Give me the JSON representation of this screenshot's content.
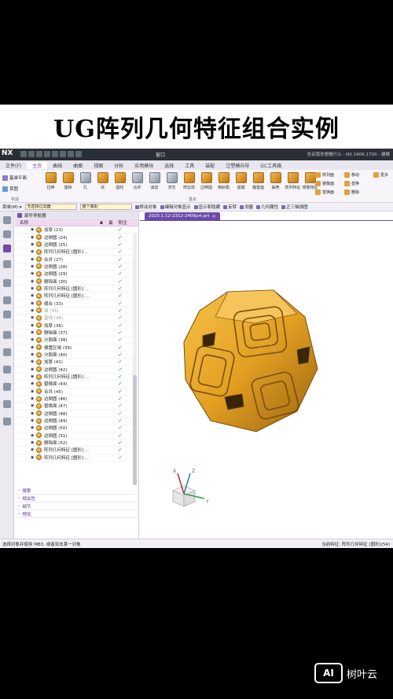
{
  "headline": "UG阵列几何特征组合实例",
  "titlebar": {
    "app": "NX",
    "window_menu": "窗口",
    "right_text": "告诉我你想做什么 - NX 2406.1700 - 建模"
  },
  "menubar": [
    "文件(F)",
    "主页",
    "曲线",
    "曲面",
    "视图",
    "分析",
    "应用模块",
    "选择",
    "工具",
    "装配",
    "注塑模向导",
    "GC工具箱"
  ],
  "menubar_active_index": 1,
  "ribbon": {
    "left": [
      "基准平面",
      "草图"
    ],
    "buttons": [
      "拉伸",
      "旋转",
      "孔",
      "块",
      "圆柱",
      "合并",
      "减去",
      "求交",
      "修剪体",
      "边倒圆",
      "倒斜角",
      "拔模",
      "偏置面",
      "抽壳",
      "阵列特征",
      "镜像特征"
    ],
    "col1": [
      "阵列面",
      "镜像面",
      "替换面"
    ],
    "col2": [
      "移动",
      "替换",
      "删除"
    ],
    "col3": [
      "更多"
    ],
    "group_labels": [
      "构造",
      "基本"
    ]
  },
  "toolbar": {
    "menu": "菜单(M) ▾",
    "filter": "无选择过滤器",
    "scope": "整个装配",
    "commands": [
      "移动对象",
      "编辑对象显示",
      "显示和隐藏",
      "反转",
      "测量",
      "几何属性",
      "正三轴测图"
    ]
  },
  "navigator": {
    "title": "部件导航器",
    "columns": {
      "name": "名称",
      "latest": "▲",
      "mod": "最",
      "note": "附注"
    },
    "features": [
      "加厚 (23)",
      "边倒圆 (24)",
      "边倒圆 (25)",
      "阵列几何特征 [圆形] ...",
      "合并 (27)",
      "边倒圆 (28)",
      "边倒圆 (29)",
      "删除面 (30)",
      "阵列几何特征 [圆形] ...",
      "阵列几何特征 [圆形] ...",
      "缝合 (33)",
      "球 (35)",
      "直线 (34)",
      "加厚 (36)",
      "删除面 (37)",
      "分割面 (38)",
      "偏置区域 (39)",
      "分割面 (40)",
      "加厚 (41)",
      "边倒圆 (42)",
      "阵列几何特征 [圆形] ...",
      "替换面 (44)",
      "合并 (45)",
      "边倒圆 (46)",
      "替换面 (47)",
      "边倒圆 (48)",
      "边倒圆 (49)",
      "边倒圆 (50)",
      "边倒圆 (51)",
      "删除面 (52)",
      "阵列几何特征 [圆形] ...",
      "阵列几何特征 [圆形] ..."
    ],
    "dimmed_indexes": [
      11,
      12
    ],
    "panels": [
      "搜索",
      "相关性",
      "细节",
      "预览"
    ]
  },
  "graphics": {
    "tab": "2025.1.12-2312-2406prt.prt",
    "model_color": "#e3a022",
    "triad": {
      "x": "X",
      "y": "Y",
      "z": "Z"
    }
  },
  "status": {
    "left": "选择对象并使用 MB3, 或者双击某一对象",
    "right": "当前特征: 阵列几何特征 [圆形](54)"
  },
  "watermark": {
    "logo": "AI",
    "text": "树叶云"
  },
  "colors": {
    "accent": "#6c4aa8",
    "title_bar": "#2a2f37",
    "check": "#2ea043"
  }
}
